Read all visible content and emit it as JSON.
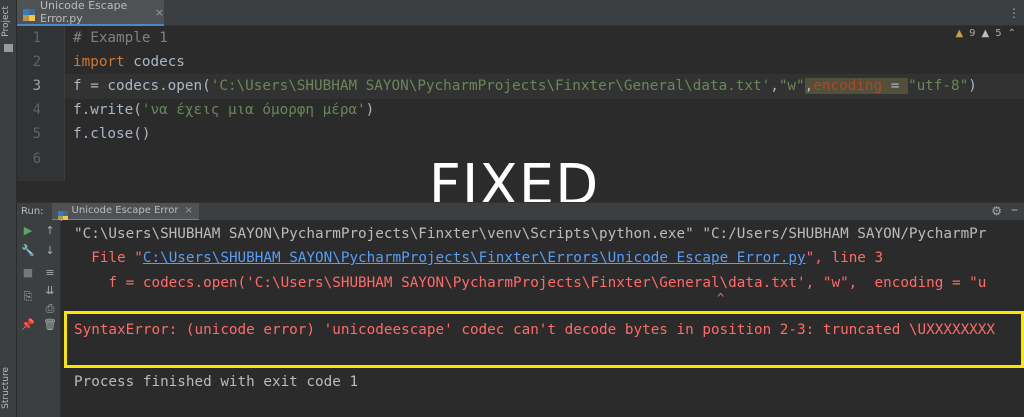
{
  "left_strip": {
    "project_label": "Project",
    "structure_label": "Structure"
  },
  "tabbar": {
    "file_tab": "Unicode Escape Error.py",
    "close": "×"
  },
  "editor": {
    "line_numbers": [
      "1",
      "2",
      "3",
      "4",
      "5",
      "6"
    ],
    "line1": {
      "comment": "# Example 1"
    },
    "line2": {
      "kw": "import",
      "rest": " codecs"
    },
    "line3": {
      "pre": "f = codecs.open(",
      "path": "'C:\\Users\\SHUBHAM SAYON\\PycharmProjects\\Finxter\\General\\data.txt'",
      "comma1": ",",
      "mode": "\"w\"",
      "comma2": ",",
      "param": "encoding",
      "eq": " = ",
      "enc": "\"utf-8\"",
      "close": ")"
    },
    "line4": {
      "pre": "f.write(",
      "str": "'να έχεις μια όμορφη μέρα'",
      "close": ")"
    },
    "line5": {
      "code": "f.close()"
    },
    "inspections": {
      "warnings": "9",
      "weak": "5"
    }
  },
  "overlay": {
    "fixed_text": "FIXED"
  },
  "run": {
    "label": "Run:",
    "tab_label": "Unicode Escape Error",
    "close": "×"
  },
  "console": {
    "cmd": "\"C:\\Users\\SHUBHAM SAYON\\PycharmProjects\\Finxter\\venv\\Scripts\\python.exe\" \"C:/Users/SHUBHAM SAYON/PycharmPr",
    "file_pre": "  File \"",
    "file_link": "C:\\Users\\SHUBHAM SAYON\\PycharmProjects\\Finxter\\Errors\\Unicode Escape Error.py",
    "file_post": "\", line 3",
    "code_line": "    f = codecs.open('C:\\Users\\SHUBHAM SAYON\\PycharmProjects\\Finxter\\General\\data.txt', \"w\",  encoding = \"u",
    "caret": "                                                                                         ^",
    "error": "SyntaxError: (unicode error) 'unicodeescape' codec can't decode bytes in position 2-3: truncated \\UXXXXXXXX",
    "exit": "Process finished with exit code 1"
  },
  "colors": {
    "highlight_box": "#fbe600",
    "error": "#ff6b68",
    "link": "#589df6"
  }
}
